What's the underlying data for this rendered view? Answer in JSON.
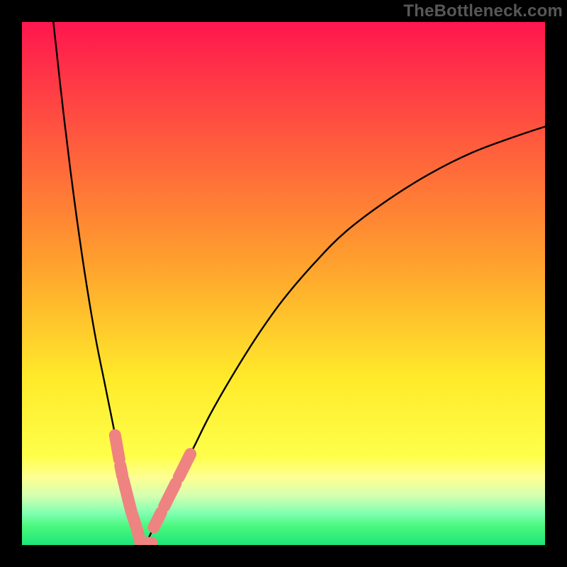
{
  "watermark": "TheBottleneck.com",
  "colors": {
    "bg_black": "#000000",
    "grad_top": "#ff164e",
    "grad_yellow": "#ffea2a",
    "grad_pale_yellow": "#feff92",
    "grad_pale_green": "#b6ffaa",
    "grad_green_a": "#49f77c",
    "grad_green_b": "#1ce67b",
    "watermark": "#575757",
    "curve": "#000000",
    "marker_fill": "#ee8381",
    "marker_stroke": "#ee8381"
  },
  "chart_data": {
    "type": "line",
    "title": "",
    "xlabel": "",
    "ylabel": "",
    "xlim": [
      0,
      100
    ],
    "ylim": [
      0,
      100
    ],
    "x_trough": 23,
    "series": [
      {
        "name": "left-branch",
        "x": [
          6,
          8,
          10,
          12,
          14,
          16,
          18,
          19,
          20,
          21,
          22,
          22.5,
          23
        ],
        "y": [
          100,
          82,
          66,
          52,
          40,
          30,
          20,
          14,
          10,
          6,
          3,
          1,
          0
        ]
      },
      {
        "name": "right-branch",
        "x": [
          23,
          24,
          25,
          26,
          28,
          30,
          33,
          36,
          40,
          45,
          50,
          56,
          62,
          70,
          78,
          86,
          94,
          100
        ],
        "y": [
          0,
          1,
          3,
          5,
          9,
          13,
          19,
          25,
          32,
          40,
          47,
          54,
          60,
          66,
          71,
          75,
          78,
          80
        ]
      }
    ],
    "markers": {
      "name": "sausage-markers",
      "kind": "capsule",
      "fill": "#ee8381",
      "items": [
        {
          "branch": "left",
          "x0": 17.8,
          "x1": 18.6
        },
        {
          "branch": "left",
          "x0": 18.8,
          "x1": 19.2
        },
        {
          "branch": "left",
          "x0": 19.4,
          "x1": 20.8
        },
        {
          "branch": "left",
          "x0": 20.9,
          "x1": 21.8
        },
        {
          "branch": "left",
          "x0": 22.0,
          "x1": 22.4
        },
        {
          "branch": "floor",
          "x0": 22.6,
          "x1": 23.6
        },
        {
          "branch": "floor",
          "x0": 23.8,
          "x1": 24.8
        },
        {
          "branch": "right",
          "x0": 25.2,
          "x1": 25.6
        },
        {
          "branch": "right",
          "x0": 25.8,
          "x1": 26.6
        },
        {
          "branch": "right",
          "x0": 27.2,
          "x1": 28.6
        },
        {
          "branch": "right",
          "x0": 28.8,
          "x1": 29.4
        },
        {
          "branch": "right",
          "x0": 30.0,
          "x1": 31.4
        },
        {
          "branch": "right",
          "x0": 31.6,
          "x1": 32.2
        }
      ]
    },
    "gradient_stops": [
      {
        "offset": 0.0,
        "color": "#ff164e"
      },
      {
        "offset": 0.45,
        "color": "#ff9d2e"
      },
      {
        "offset": 0.68,
        "color": "#ffea2a"
      },
      {
        "offset": 0.83,
        "color": "#feff4a"
      },
      {
        "offset": 0.87,
        "color": "#feff92"
      },
      {
        "offset": 0.905,
        "color": "#d6ffb0"
      },
      {
        "offset": 0.94,
        "color": "#7dffb0"
      },
      {
        "offset": 0.965,
        "color": "#49f77c"
      },
      {
        "offset": 1.0,
        "color": "#1ce67b"
      }
    ]
  }
}
